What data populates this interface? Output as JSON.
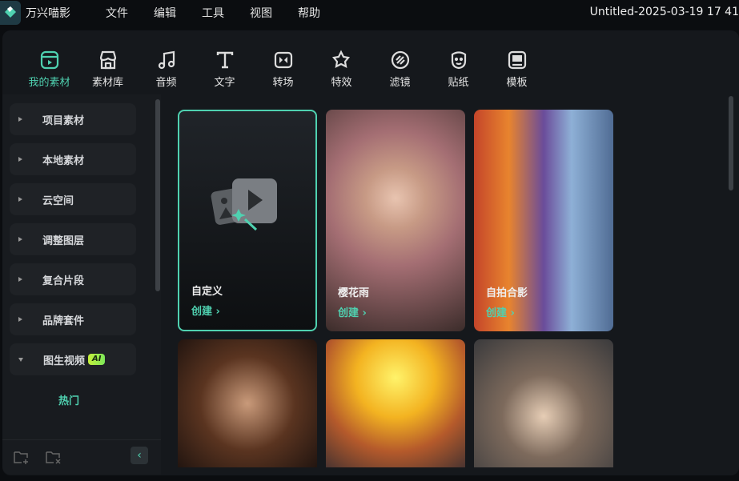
{
  "app": {
    "name": "万兴喵影",
    "title": "Untitled-2025-03-19 17 41"
  },
  "menu": [
    "文件",
    "编辑",
    "工具",
    "视图",
    "帮助"
  ],
  "toolbar": [
    {
      "label": "我的素材",
      "icon": "my-media-icon",
      "active": true
    },
    {
      "label": "素材库",
      "icon": "store-icon"
    },
    {
      "label": "音频",
      "icon": "music-icon"
    },
    {
      "label": "文字",
      "icon": "text-icon"
    },
    {
      "label": "转场",
      "icon": "transition-icon"
    },
    {
      "label": "特效",
      "icon": "effects-icon"
    },
    {
      "label": "滤镜",
      "icon": "filter-icon"
    },
    {
      "label": "贴纸",
      "icon": "sticker-icon"
    },
    {
      "label": "模板",
      "icon": "template-icon"
    }
  ],
  "sidebar": {
    "items": [
      "项目素材",
      "本地素材",
      "云空间",
      "调整图层",
      "复合片段",
      "品牌套件",
      "图生视频"
    ],
    "ai_badge": "AI",
    "sub_active": "热门"
  },
  "cards": [
    {
      "title": "自定义",
      "action": "创建 ›"
    },
    {
      "title": "樱花雨",
      "action": "创建 ›"
    },
    {
      "title": "自拍合影",
      "action": "创建 ›"
    }
  ],
  "colors": {
    "accent": "#4fd1b0"
  }
}
